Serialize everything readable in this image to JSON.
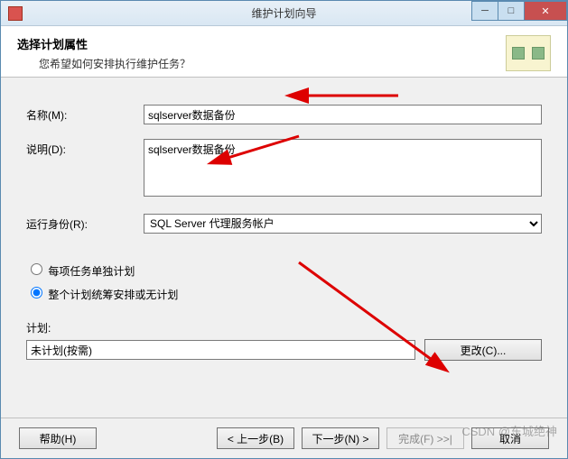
{
  "titlebar": {
    "title": "维护计划向导"
  },
  "header": {
    "heading": "选择计划属性",
    "sub": "您希望如何安排执行维护任务？"
  },
  "form": {
    "name_label": "名称(M):",
    "name_value": "sqlserver数据备份",
    "desc_label": "说明(D):",
    "desc_value": "sqlserver数据备份",
    "runas_label": "运行身份(R):",
    "runas_value": "SQL Server 代理服务帐户",
    "radio_each": "每项任务单独计划",
    "radio_all": "整个计划统筹安排或无计划",
    "schedule_label": "计划:",
    "schedule_value": "未计划(按需)",
    "change_btn": "更改(C)..."
  },
  "footer": {
    "help": "帮助(H)",
    "back": "< 上一步(B)",
    "next": "下一步(N) >",
    "finish": "完成(F) >>|",
    "cancel": "取消"
  },
  "watermark": "CSDN @东城绝神"
}
